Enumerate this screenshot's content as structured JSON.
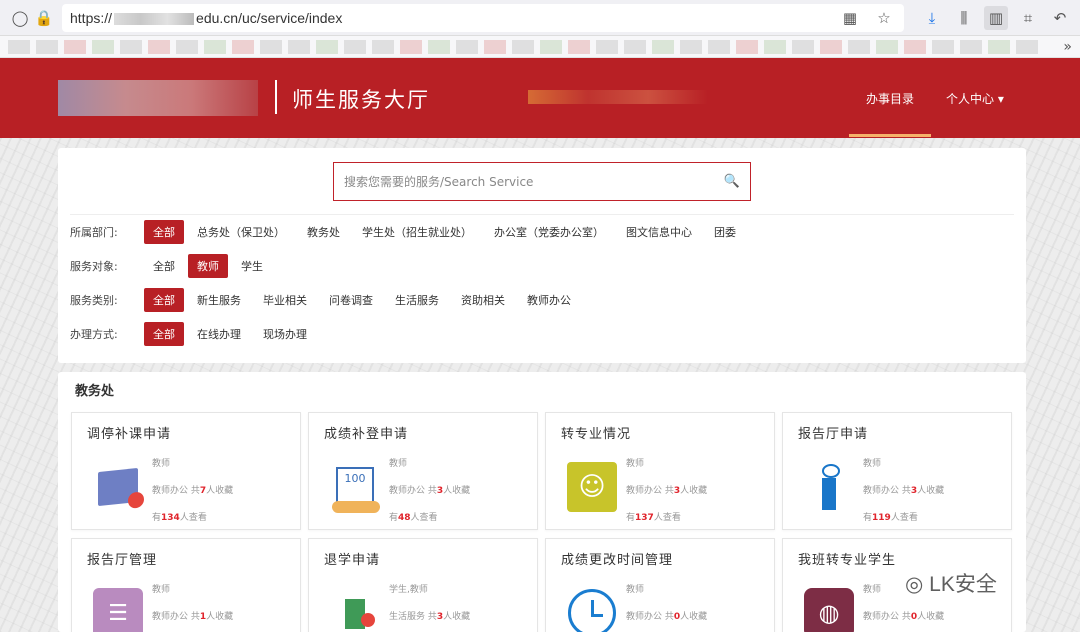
{
  "browser": {
    "url_prefix": "https://",
    "url_suffix": "edu.cn/uc/service/index"
  },
  "header": {
    "title": "师生服务大厅",
    "nav": {
      "catalog": "办事目录",
      "personal": "个人中心 ▾"
    }
  },
  "search": {
    "placeholder": "搜索您需要的服务/Search Service"
  },
  "filters": [
    {
      "label": "所属部门:",
      "options": [
        "全部",
        "总务处（保卫处）",
        "教务处",
        "学生处（招生就业处）",
        "办公室（党委办公室）",
        "图文信息中心",
        "团委"
      ],
      "selected": 0
    },
    {
      "label": "服务对象:",
      "options": [
        "全部",
        "教师",
        "学生"
      ],
      "selected": 1
    },
    {
      "label": "服务类别:",
      "options": [
        "全部",
        "新生服务",
        "毕业相关",
        "问卷调查",
        "生活服务",
        "资助相关",
        "教师办公"
      ],
      "selected": 0
    },
    {
      "label": "办理方式:",
      "options": [
        "全部",
        "在线办理",
        "现场办理"
      ],
      "selected": 0
    }
  ],
  "section": {
    "title": "教务处",
    "cards": [
      {
        "title": "调停补课申请",
        "audience": "教师",
        "category": "教师办公",
        "fav_prefix": "共",
        "favorites": "7",
        "fav_suffix": "人收藏",
        "views_prefix": "有",
        "views": "134",
        "views_suffix": "人查看",
        "icon": "book-icon"
      },
      {
        "title": "成绩补登申请",
        "audience": "教师",
        "category": "教师办公",
        "fav_prefix": "共",
        "favorites": "3",
        "fav_suffix": "人收藏",
        "views_prefix": "有",
        "views": "48",
        "views_suffix": "人查看",
        "icon": "score-sheet-icon"
      },
      {
        "title": "转专业情况",
        "audience": "教师",
        "category": "教师办公",
        "fav_prefix": "共",
        "favorites": "3",
        "fav_suffix": "人收藏",
        "views_prefix": "有",
        "views": "137",
        "views_suffix": "人查看",
        "icon": "user-card-icon"
      },
      {
        "title": "报告厅申请",
        "audience": "教师",
        "category": "教师办公",
        "fav_prefix": "共",
        "favorites": "3",
        "fav_suffix": "人收藏",
        "views_prefix": "有",
        "views": "119",
        "views_suffix": "人查看",
        "icon": "podium-icon"
      },
      {
        "title": "报告厅管理",
        "audience": "教师",
        "category": "教师办公",
        "fav_prefix": "共",
        "favorites": "1",
        "fav_suffix": "人收藏",
        "icon": "clipboard-icon"
      },
      {
        "title": "退学申请",
        "audience": "学生,教师",
        "category": "生活服务",
        "fav_prefix": "共",
        "favorites": "3",
        "fav_suffix": "人收藏",
        "icon": "school-icon"
      },
      {
        "title": "成绩更改时间管理",
        "audience": "教师",
        "category": "教师办公",
        "fav_prefix": "共",
        "favorites": "0",
        "fav_suffix": "人收藏",
        "icon": "clock-icon"
      },
      {
        "title": "我班转专业学生",
        "audience": "教师",
        "category": "教师办公",
        "fav_prefix": "共",
        "favorites": "0",
        "fav_suffix": "人收藏",
        "icon": "globe-icon"
      }
    ]
  },
  "watermark": "LK安全",
  "colors": {
    "brand": "#b82025",
    "accent_number": "#e0252d"
  }
}
